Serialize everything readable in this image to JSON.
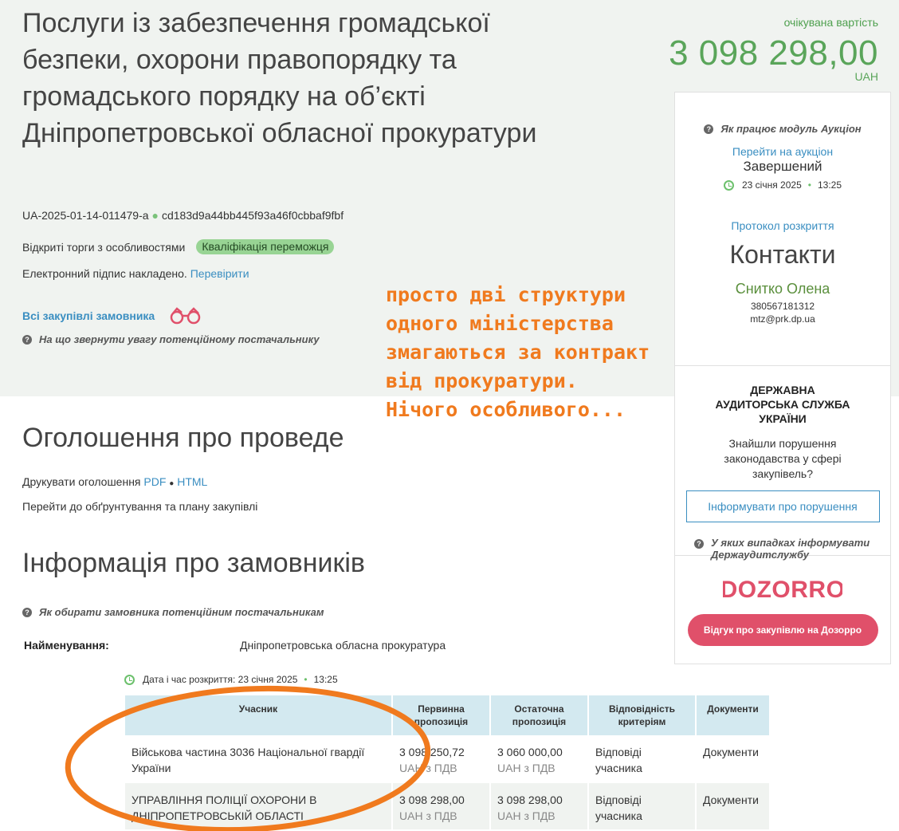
{
  "page": {
    "title": "Послуги із забезпечення громадської безпеки, охорони правопорядку та громадського порядку на об’єкті Дніпропетровської обласної прокуратури",
    "tender_id": "UA-2025-01-14-011479-a",
    "tender_hash": "cd183d9a44bb445f93a46f0cbbaf9fbf",
    "procedure_type": "Відкриті торги з особливостями",
    "status_badge": "Кваліфікація переможця",
    "signature_text": "Електронний підпис накладено.",
    "signature_link": "Перевірити",
    "all_purchases_link": "Всі закупівлі замовника",
    "supplier_hint": "На що звернути увагу потенційному постачальнику"
  },
  "cost": {
    "label": "очікувана вартість",
    "value": "3 098 298,00",
    "currency": "UAH"
  },
  "sidebar": {
    "auction_help": "Як працює модуль Аукціон",
    "auction_link": "Перейти на аукціон",
    "auction_status": "Завершений",
    "auction_date": "23 січня 2025",
    "auction_time": "13:25",
    "protocol_link": "Протокол розкриття",
    "contacts_title": "Контакти",
    "contact_name": "Снитко Олена",
    "contact_phone": "380567181312",
    "contact_email": "mtz@prk.dp.ua",
    "audit_title": "ДЕРЖАВНА АУДИТОРСЬКА СЛУЖБА УКРАЇНИ",
    "audit_question": "Знайшли порушення законодавства у сфері закупівель?",
    "audit_button": "Інформувати про порушення",
    "audit_hint": "У яких випадках інформувати Держаудитслужбу",
    "dozorro_logo": "DOZORRO",
    "dozorro_button": "Відгук про закупівлю на Дозорро"
  },
  "announcement": {
    "title": "Оголошення про проведе",
    "print_label": "Друкувати оголошення",
    "print_pdf": "PDF",
    "print_html": "HTML",
    "justification_link": "Перейти до обґрунтування та плану закупівлі"
  },
  "customers": {
    "title": "Інформація про замовників",
    "hint": "Як обирати замовника потенційним постачальникам",
    "name_label": "Найменування:",
    "name_value": "Дніпропетровська обласна прокуратура"
  },
  "bids": {
    "opening_label": "Дата і час розкриття: 23 січня 2025",
    "opening_time": "13:25",
    "headers": {
      "participant": "Учасник",
      "initial": "Первинна пропозиція",
      "final": "Остаточна пропозиція",
      "criteria": "Відповідність критеріям",
      "documents": "Документи"
    },
    "rows": [
      {
        "participant": "Військова частина 3036 Національної гвардії України",
        "initial": "3 098 250,72",
        "initial_vat": "UAH з ПДВ",
        "final": "3 060 000,00",
        "final_vat": "UAH з ПДВ",
        "criteria": "Відповіді учасника",
        "documents": "Документи"
      },
      {
        "participant": "УПРАВЛІННЯ ПОЛІЦІЇ ОХОРОНИ В ДНІПРОПЕТРОВСЬКІЙ ОБЛАСТІ",
        "initial": "3 098 298,00",
        "initial_vat": "UAH з ПДВ",
        "final": "3 098 298,00",
        "final_vat": "UAH з ПДВ",
        "criteria": "Відповіді учасника",
        "documents": "Документи"
      }
    ]
  },
  "annotation": {
    "text": "просто дві структури\nодного міністерства\nзмагаються за контракт\nвід прокуратури.\nНічого особливого...",
    "color": "#f07a1e"
  }
}
